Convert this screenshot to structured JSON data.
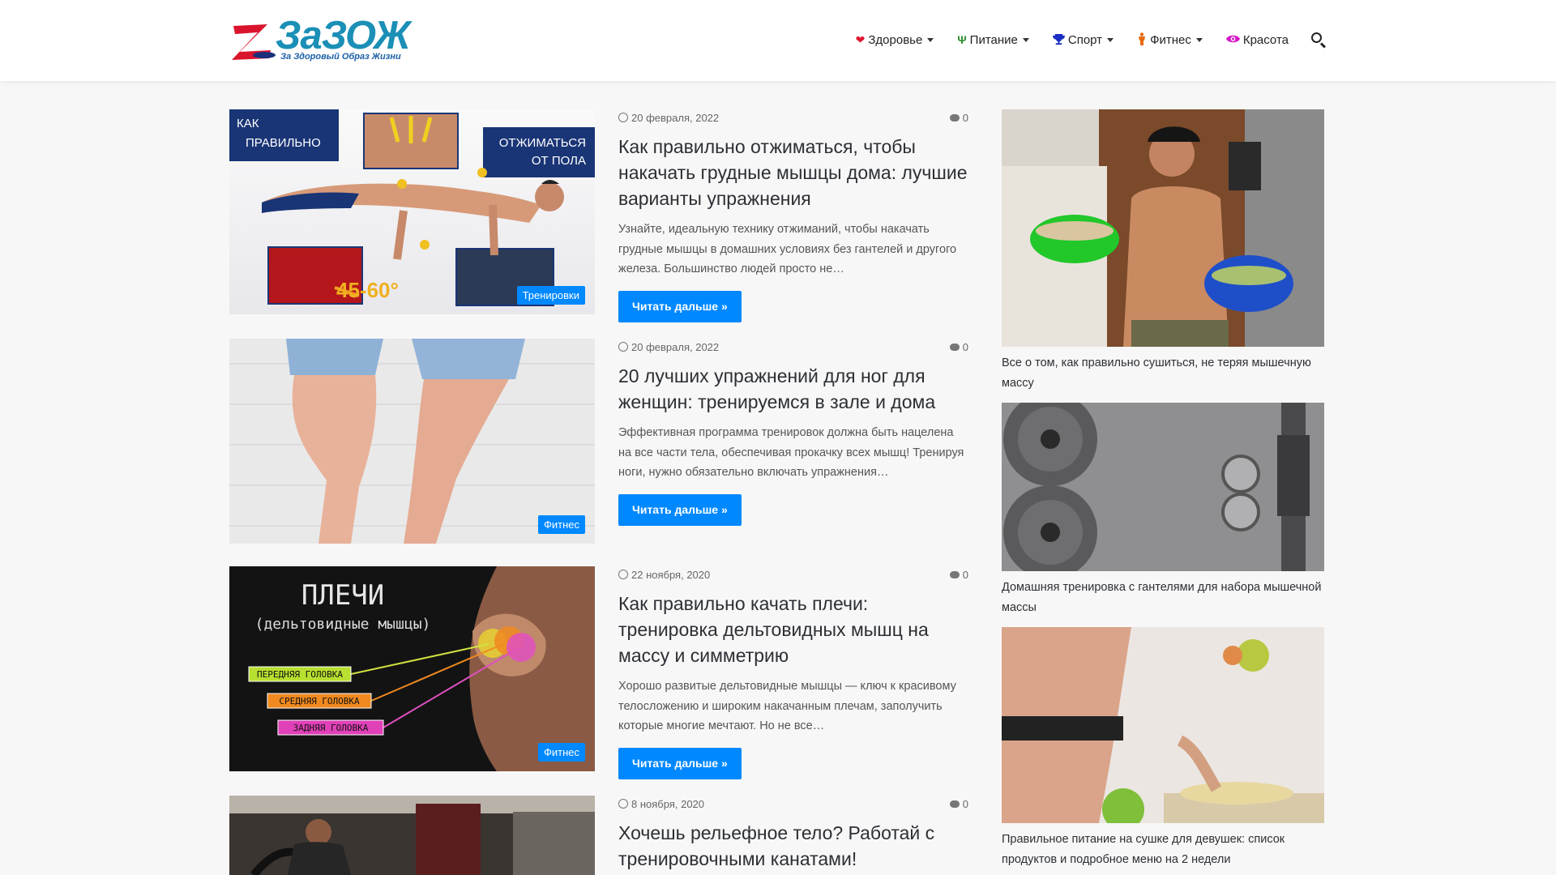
{
  "site": {
    "logo_text": "ЗаЗОЖ",
    "tagline": "За Здоровый Образ Жизни"
  },
  "nav": [
    {
      "label": "Здоровье",
      "icon": "heart-icon",
      "color": "#e0182d",
      "dropdown": true
    },
    {
      "label": "Питание",
      "icon": "cutlery-icon",
      "color": "#2e8b2e",
      "dropdown": true
    },
    {
      "label": "Спорт",
      "icon": "trophy-icon",
      "color": "#1a2fc4",
      "dropdown": true
    },
    {
      "label": "Фитнес",
      "icon": "person-icon",
      "color": "#e86a10",
      "dropdown": true
    },
    {
      "label": "Красота",
      "icon": "eye-icon",
      "color": "#d616c9",
      "dropdown": false
    }
  ],
  "accent_color": "#0088ff",
  "posts": [
    {
      "date": "20 февраля, 2022",
      "comments": "0",
      "title": "Как правильно отжиматься, чтобы накачать грудные мышцы дома: лучшие варианты упражнения",
      "excerpt": "Узнайте, идеальную технику отжиманий, чтобы накачать грудные мышцы в домашних условиях без гантелей и другого железа. Большинство людей просто не…",
      "button": "Читать дальше »",
      "category": "Тренировки",
      "image_text": {
        "left_top_1": "КАК",
        "left_top_2": "ПРАВИЛЬНО",
        "right_top_1": "ОТЖИМАТЬСЯ",
        "right_top_2": "ОТ ПОЛА",
        "angle": "45-60°"
      }
    },
    {
      "date": "20 февраля, 2022",
      "comments": "0",
      "title": "20 лучших упражнений для ног для женщин: тренируемся в зале и дома",
      "excerpt": "Эффективная программа тренировок должна быть нацелена на все части тела, обеспечивая прокачку всех мышц! Тренируя ноги, нужно обязательно включать упражнения…",
      "button": "Читать дальше »",
      "category": "Фитнес"
    },
    {
      "date": "22 ноября, 2020",
      "comments": "0",
      "title": "Как правильно качать плечи: тренировка дельтовидных мышц на массу и симметрию",
      "excerpt": "Хорошо развитые дельтовидные мышцы — ключ к красивому телосложению и широким накачанным плечам, заполучить которые многие мечтают. Но не все…",
      "button": "Читать дальше »",
      "category": "Фитнес",
      "image_text": {
        "heading": "ПЛЕЧИ",
        "subheading": "(дельтовидные мышцы)",
        "label_front": "ПЕРЕДНЯЯ ГОЛОВКА",
        "label_middle": "СРЕДНЯЯ ГОЛОВКА",
        "label_rear": "ЗАДНЯЯ ГОЛОВКА"
      }
    },
    {
      "date": "8 ноября, 2020",
      "comments": "0",
      "title": "Хочешь рельефное тело? Работай с тренировочными канатами!"
    }
  ],
  "sidebar": [
    {
      "caption": "Все о том, как правильно сушиться, не теряя мышечную массу"
    },
    {
      "caption": "Домашняя тренировка с гантелями для набора мышечной массы"
    },
    {
      "caption": "Правильное питание на сушке для девушек: список продуктов и подробное меню на 2 недели"
    }
  ]
}
